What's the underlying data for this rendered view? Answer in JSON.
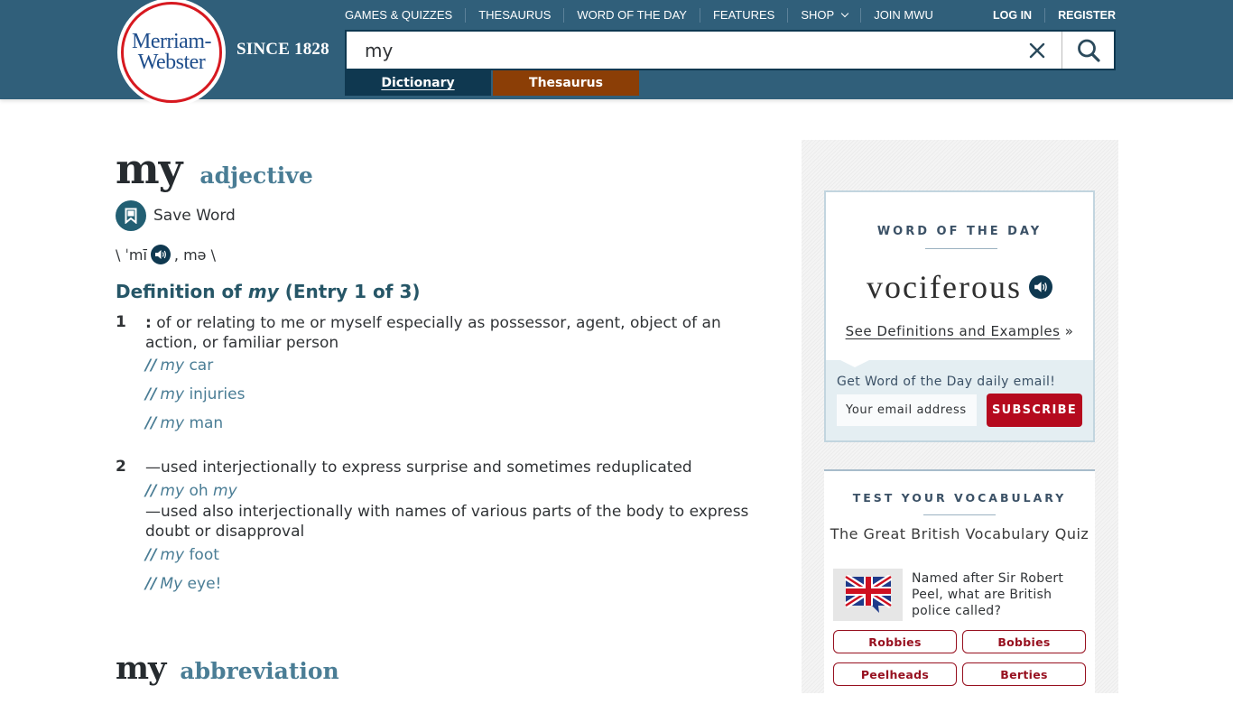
{
  "header": {
    "logo": {
      "line1": "Merriam-",
      "line2": "Webster"
    },
    "since": "SINCE 1828",
    "nav": [
      {
        "label": "GAMES & QUIZZES"
      },
      {
        "label": "THESAURUS"
      },
      {
        "label": "WORD OF THE DAY"
      },
      {
        "label": "FEATURES"
      },
      {
        "label": "SHOP",
        "has_dropdown": true
      },
      {
        "label": "JOIN MWU"
      }
    ],
    "auth": {
      "login": "LOG IN",
      "register": "REGISTER"
    },
    "search": {
      "value": "my",
      "clear_icon": "close-icon",
      "search_icon": "search-icon"
    },
    "tabs": [
      {
        "label": "Dictionary",
        "active": true,
        "color": "#0f3850"
      },
      {
        "label": "Thesaurus",
        "active": false,
        "color": "#8b3e06"
      }
    ]
  },
  "entry1": {
    "headword": "my",
    "pos": "adjective",
    "save_label": "Save Word",
    "pron": {
      "open": "\\ ˈmī",
      "close": ", mə \\"
    },
    "def_title": {
      "prefix": "Definition of ",
      "word": "my",
      "suffix": " (Entry 1 of 3)"
    },
    "senses": [
      {
        "num": "1",
        "colon": ":",
        "text": " of or relating to me or myself especially as possessor, agent, object of an action, or familiar person",
        "examples": [
          {
            "sl": "//",
            "em": "my",
            "rest": " car"
          },
          {
            "sl": "//",
            "em": "my",
            "rest": " injuries"
          },
          {
            "sl": "//",
            "em": "my",
            "rest": " man"
          }
        ]
      },
      {
        "num": "2",
        "text": "—used interjectionally to express surprise and sometimes reduplicated",
        "example1": {
          "sl": "//",
          "em": "my",
          "mid": " oh ",
          "em2": "my"
        },
        "text2": "—used also interjectionally with names of various parts of the body to express doubt or disapproval",
        "examples2": [
          {
            "sl": "//",
            "em": "my",
            "rest": " foot"
          },
          {
            "sl": "//",
            "em": "My",
            "rest": " eye!"
          }
        ]
      }
    ]
  },
  "entry2": {
    "headword": "my",
    "pos": "abbreviation"
  },
  "sidebar": {
    "wod": {
      "heading": "WORD OF THE DAY",
      "word": "vociferous",
      "link": "See Definitions and Examples",
      "link_suffix": " »",
      "email_label": "Get Word of the Day daily email!",
      "email_placeholder": "Your email address",
      "subscribe": "SUBSCRIBE"
    },
    "quiz": {
      "heading": "TEST YOUR VOCABULARY",
      "title": "The Great British Vocabulary Quiz",
      "question": "Named after Sir Robert Peel, what are British police called?",
      "answers": [
        "Robbies",
        "Bobbies",
        "Peelheads",
        "Berties"
      ]
    }
  },
  "colors": {
    "header_bg": "#305f7a",
    "accent": "#265667",
    "subscribe": "#b50a1e",
    "answer": "#97101f"
  }
}
